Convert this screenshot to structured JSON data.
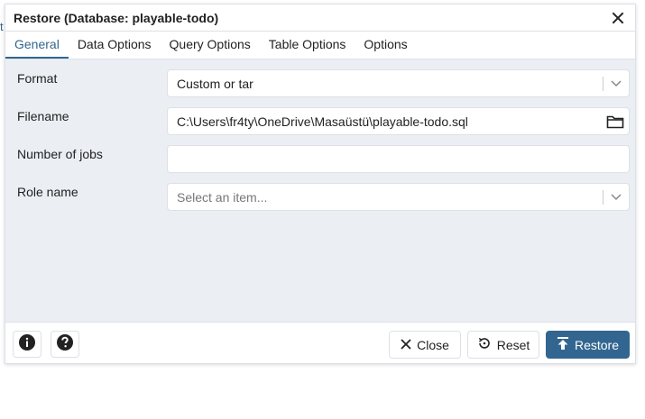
{
  "edge_fragment": "t",
  "dialog": {
    "title": "Restore (Database: playable-todo)"
  },
  "tabs": [
    {
      "label": "General",
      "active": true
    },
    {
      "label": "Data Options",
      "active": false
    },
    {
      "label": "Query Options",
      "active": false
    },
    {
      "label": "Table Options",
      "active": false
    },
    {
      "label": "Options",
      "active": false
    }
  ],
  "form": {
    "format": {
      "label": "Format",
      "value": "Custom or tar"
    },
    "filename": {
      "label": "Filename",
      "value": "C:\\Users\\fr4ty\\OneDrive\\Masaüstü\\playable-todo.sql"
    },
    "jobs": {
      "label": "Number of jobs",
      "value": ""
    },
    "role": {
      "label": "Role name",
      "placeholder": "Select an item..."
    }
  },
  "footer": {
    "close_label": "Close",
    "reset_label": "Reset",
    "restore_label": "Restore"
  },
  "icons": {
    "info": "info-icon",
    "help": "help-icon",
    "close": "close-icon",
    "reset": "reset-icon",
    "restore": "upload-icon",
    "folder": "folder-icon",
    "chevron": "chevron-down-icon"
  },
  "colors": {
    "accent": "#326690",
    "content_bg": "#ebeef3",
    "border": "#dde0e6"
  }
}
